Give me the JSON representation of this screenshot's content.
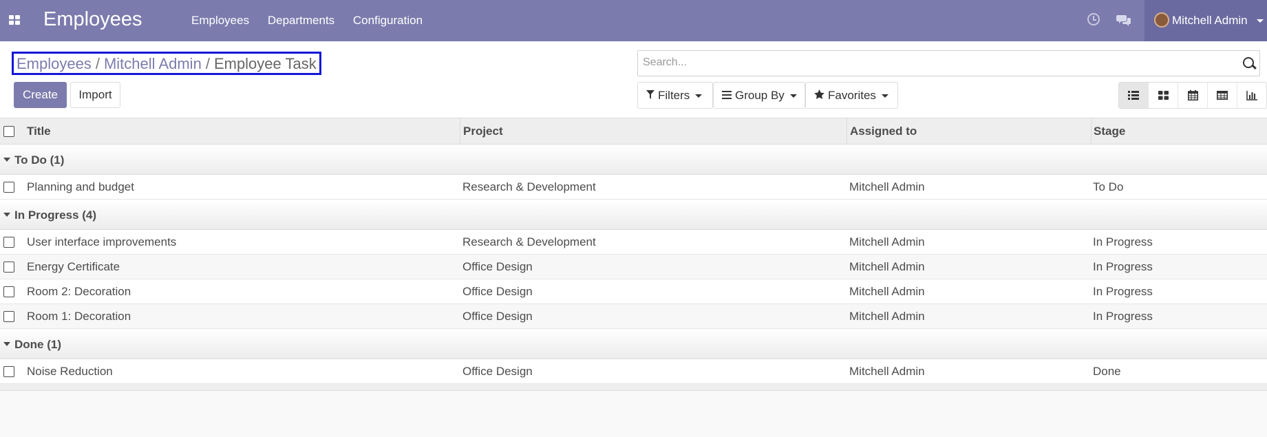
{
  "navbar": {
    "app_title": "Employees",
    "menu": [
      "Employees",
      "Departments",
      "Configuration"
    ],
    "user_name": "Mitchell Admin",
    "brand_color": "#7c7bad"
  },
  "breadcrumb": {
    "items": [
      "Employees",
      "Mitchell Admin"
    ],
    "active": "Employee Task",
    "separator": "/"
  },
  "buttons": {
    "create": "Create",
    "import": "Import"
  },
  "search": {
    "placeholder": "Search..."
  },
  "filters": {
    "filters_label": "Filters",
    "group_by_label": "Group By",
    "favorites_label": "Favorites"
  },
  "views": [
    "list-view-icon",
    "kanban-view-icon",
    "calendar-view-icon",
    "pivot-view-icon",
    "graph-view-icon"
  ],
  "table": {
    "columns": [
      "Title",
      "Project",
      "Assigned to",
      "Stage"
    ],
    "groups": [
      {
        "label": "To Do (1)",
        "rows": [
          [
            "Planning and budget",
            "Research & Development",
            "Mitchell Admin",
            "To Do"
          ]
        ]
      },
      {
        "label": "In Progress (4)",
        "rows": [
          [
            "User interface improvements",
            "Research & Development",
            "Mitchell Admin",
            "In Progress"
          ],
          [
            "Energy Certificate",
            "Office Design",
            "Mitchell Admin",
            "In Progress"
          ],
          [
            "Room 2: Decoration",
            "Office Design",
            "Mitchell Admin",
            "In Progress"
          ],
          [
            "Room 1: Decoration",
            "Office Design",
            "Mitchell Admin",
            "In Progress"
          ]
        ]
      },
      {
        "label": "Done (1)",
        "rows": [
          [
            "Noise Reduction",
            "Office Design",
            "Mitchell Admin",
            "Done"
          ]
        ]
      }
    ]
  }
}
